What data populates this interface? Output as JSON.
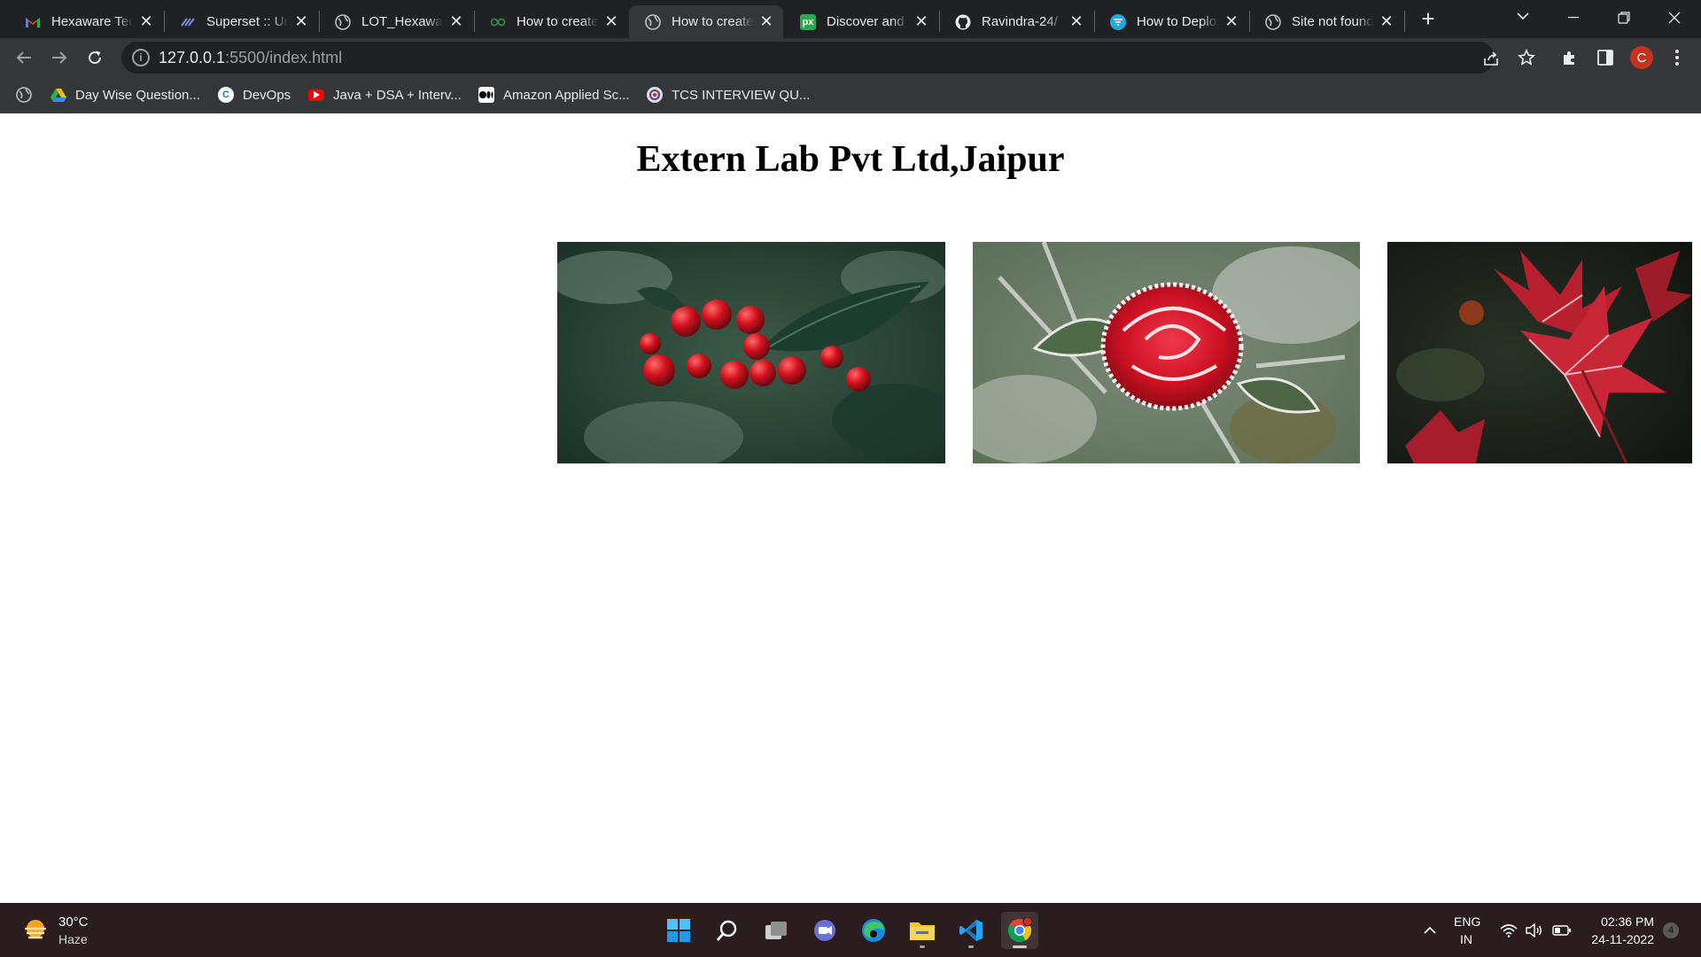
{
  "browser": {
    "tabs": [
      {
        "title": "Hexaware Technologies",
        "favicon": "gmail-icon",
        "active": false
      },
      {
        "title": "Superset :: Unified",
        "favicon": "superset-icon",
        "active": false
      },
      {
        "title": "LOT_Hexaware",
        "favicon": "globe-icon",
        "active": false
      },
      {
        "title": "How to create",
        "favicon": "geeksforgeeks-icon",
        "active": false
      },
      {
        "title": "How to create",
        "favicon": "globe-icon",
        "active": true
      },
      {
        "title": "Discover and",
        "favicon": "500px-icon",
        "active": false
      },
      {
        "title": "Ravindra-24/",
        "favicon": "github-icon",
        "active": false
      },
      {
        "title": "How to Deploy",
        "favicon": "netlify-icon",
        "active": false
      },
      {
        "title": "Site not found",
        "favicon": "globe-icon",
        "active": false
      }
    ],
    "address": {
      "host": "127.0.0.1",
      "rest": ":5500/index.html"
    },
    "bookmarks": [
      {
        "label": "Day Wise Question...",
        "icon": "google-drive-icon"
      },
      {
        "label": "DevOps",
        "icon": "c-logo-icon"
      },
      {
        "label": "Java + DSA + Interv...",
        "icon": "youtube-icon"
      },
      {
        "label": "Amazon Applied Sc...",
        "icon": "medium-icon"
      },
      {
        "label": "TCS INTERVIEW QU...",
        "icon": "circle-logo-icon"
      }
    ],
    "profile_initial": "C"
  },
  "page": {
    "heading": "Extern Lab Pvt Ltd,Jaipur",
    "images": [
      {
        "name": "holly-berries-photo"
      },
      {
        "name": "frosted-rose-photo"
      },
      {
        "name": "red-leaves-photo"
      }
    ]
  },
  "taskbar": {
    "weather_temp": "30°C",
    "weather_desc": "Haze",
    "lang_top": "ENG",
    "lang_bottom": "IN",
    "time": "02:36 PM",
    "date": "24-11-2022",
    "notification_count": "4"
  },
  "colors": {
    "tab_strip": "#202124",
    "toolbar": "#35363a",
    "taskbar": "#2b1d1f",
    "profile": "#c5331f"
  }
}
